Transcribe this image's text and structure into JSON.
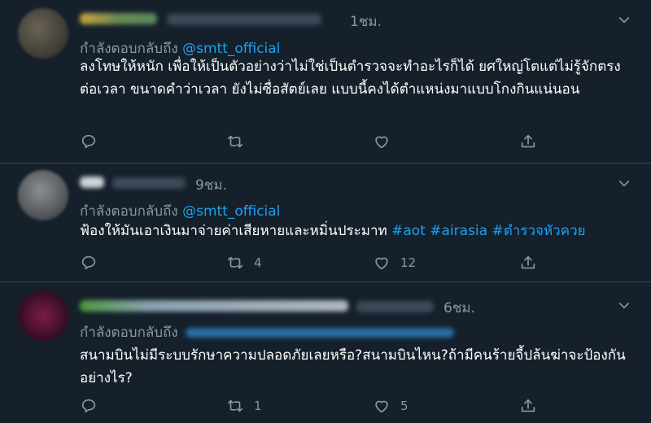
{
  "tweets": [
    {
      "time": "1ชม.",
      "reply_prefix": "กำลังตอบกลับถึง",
      "reply_handle": "@smtt_official",
      "text": "ลงโทษให้หนัก เพื่อให้เป็นตัวอย่างว่าไม่ใช่เป็นตำรวจจะทำอะไรก็ได้ ยศใหญ่โตแต่ไม่รู้จักตรงต่อเวลา ขนาดคำว่าเวลา ยังไม่ซื่อสัตย์เลย แบบนี้คงได้ตำแหน่งมาแบบโกงกินแน่นอน",
      "hashtags": [],
      "retweets": "",
      "likes": ""
    },
    {
      "time": "9ชม.",
      "reply_prefix": "กำลังตอบกลับถึง",
      "reply_handle": "@smtt_official",
      "text": "ฟ้องให้มันเอาเงินมาจ่ายค่าเสียหายและหมิ่นประมาท",
      "hashtags": [
        "#aot",
        "#airasia",
        "#ตำรวจหัวควย"
      ],
      "retweets": "4",
      "likes": "12"
    },
    {
      "time": "6ชม.",
      "reply_prefix": "กำลังตอบกลับถึง",
      "reply_handle": "",
      "text": "สนามบินไม่มีระบบรักษาความปลอดภัยเลยหรือ?สนามบินไหน?ถ้ามีคนร้ายจี้ปล้นฆ่าจะป้องกันอย่างไร?",
      "hashtags": [],
      "retweets": "1",
      "likes": "5"
    }
  ],
  "icons": {
    "reply": "reply-icon",
    "retweet": "retweet-icon",
    "like": "heart-icon",
    "share": "share-icon",
    "more": "chevron-down-icon"
  },
  "colors": {
    "background": "#15202b",
    "divider": "#38444d",
    "muted": "#8899a6",
    "accent": "#1da1f2",
    "text": "#ffffff"
  }
}
